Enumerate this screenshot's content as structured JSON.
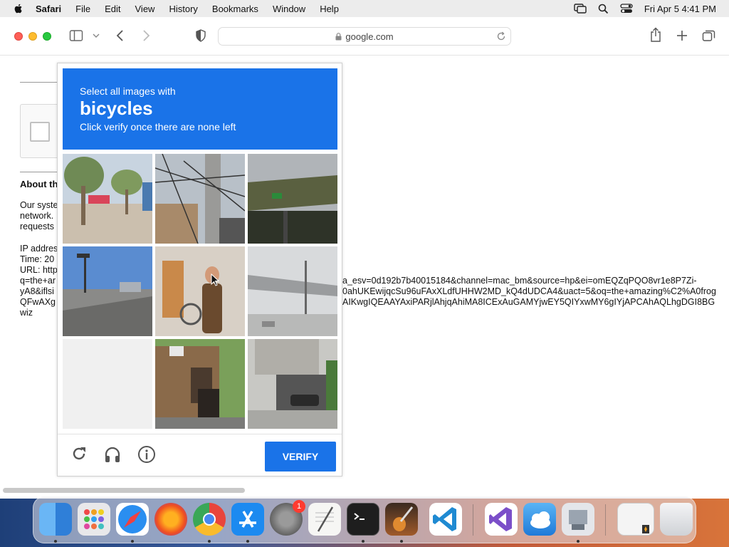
{
  "menubar": {
    "app_name": "Safari",
    "items": [
      "File",
      "Edit",
      "View",
      "History",
      "Bookmarks",
      "Window",
      "Help"
    ],
    "clock": "Fri Apr 5  4:41 PM"
  },
  "browser": {
    "address": "google.com"
  },
  "page": {
    "about_heading": "About th",
    "para1": [
      "Our syste",
      "network.",
      "requests"
    ],
    "para2": [
      "IP addres",
      "Time: 20",
      "URL: http",
      "q=the+ar",
      "yA8&iflsi",
      "QFwAXg",
      "wiz"
    ],
    "url_lines": [
      "a_esv=0d192b7b40015184&channel=mac_bm&source=hp&ei=omEQZqPQO8vr1e8P7Zi-",
      "0ahUKEwijqcSu96uFAxXLdfUHHW2MD_kQ4dUDCA4&uact=5&oq=the+amazing%C2%A0frog",
      "AIKwgIQEAAYAxiPARjlAhjqAhiMA8ICExAuGAMYjwEY5QIYxwMY6gIYjAPCAhAQLhgDGI8BG"
    ]
  },
  "captcha": {
    "header_line1": "Select all images with",
    "header_keyword": "bicycles",
    "header_line3": "Click verify once there are none left",
    "verify_label": "VERIFY",
    "tiles": [
      "tile-street-trees",
      "tile-utility-pole",
      "tile-overpass",
      "tile-intersection",
      "tile-person-bicycle",
      "tile-highway",
      "tile-faded-blank",
      "tile-house-person",
      "tile-garage-car"
    ]
  },
  "dock": {
    "apps": [
      "finder",
      "launchpad",
      "safari",
      "firefox",
      "chrome",
      "app-store",
      "system-settings",
      "textedit",
      "terminal",
      "garageband",
      "vscode",
      "visual-studio",
      "cloud-app",
      "utility-app",
      "documents-stack",
      "trash"
    ],
    "settings_badge": "1"
  },
  "colors": {
    "captcha_blue": "#1a73e8",
    "menubar_bg": "#ececec"
  }
}
